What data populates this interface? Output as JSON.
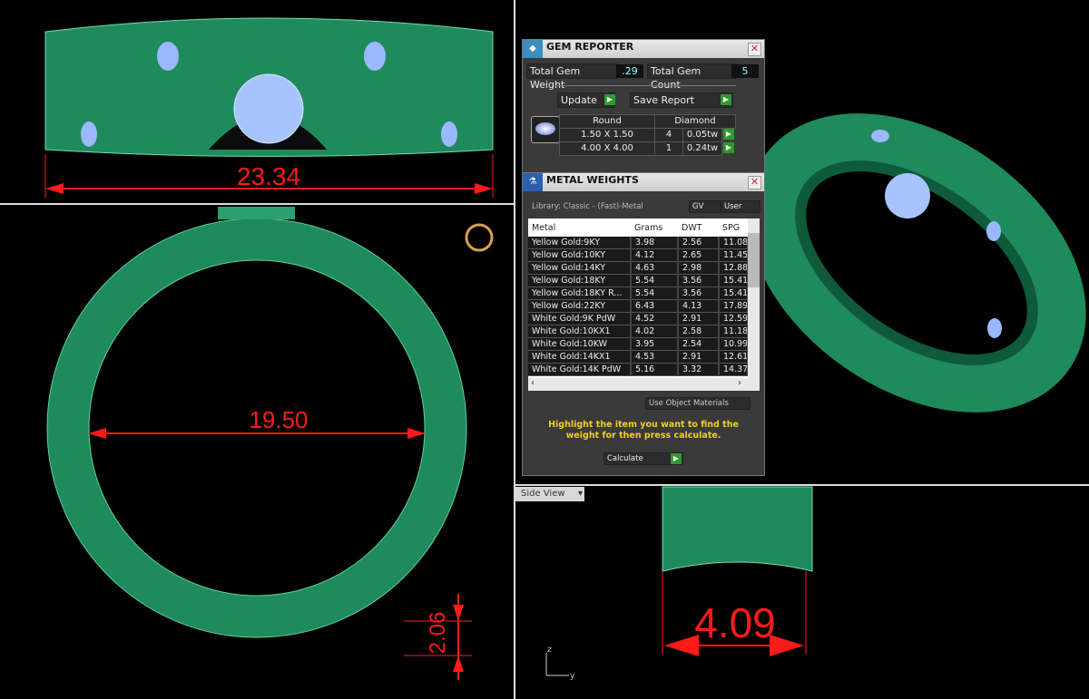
{
  "viewports": {
    "front_dim": "23.34",
    "top_dim": "19.50",
    "thickness_dim": "2.06",
    "side_dim": "4.09",
    "side_view_label": "Side View",
    "axis_z": "z",
    "axis_y": "y"
  },
  "gem_reporter": {
    "title": "GEM REPORTER",
    "total_weight_label": "Total Gem Weight",
    "total_weight": ".29",
    "total_count_label": "Total Gem Count",
    "total_count": "5",
    "update_label": "Update",
    "save_label": "Save Report",
    "shape": "Round",
    "type": "Diamond",
    "rows": [
      {
        "size": "1.50 X 1.50",
        "count": "4",
        "weight": "0.05tw"
      },
      {
        "size": "4.00 X 4.00",
        "count": "1",
        "weight": "0.24tw"
      }
    ]
  },
  "metal_weights": {
    "title": "METAL WEIGHTS",
    "library": "Library: Classic - (Fast)-Metal",
    "gv_label": "GV",
    "user_label": "User",
    "columns": [
      "Metal",
      "Grams",
      "DWT",
      "SPG"
    ],
    "rows": [
      [
        "Yellow Gold:9KY",
        "3.98",
        "2.56",
        "11.08"
      ],
      [
        "Yellow Gold:10KY",
        "4.12",
        "2.65",
        "11.45"
      ],
      [
        "Yellow Gold:14KY",
        "4.63",
        "2.98",
        "12.88"
      ],
      [
        "Yellow Gold:18KY",
        "5.54",
        "3.56",
        "15.41"
      ],
      [
        "Yellow Gold:18KY R...",
        "5.54",
        "3.56",
        "15.41"
      ],
      [
        "Yellow Gold:22KY",
        "6.43",
        "4.13",
        "17.89"
      ],
      [
        "White Gold:9K PdW",
        "4.52",
        "2.91",
        "12.59"
      ],
      [
        "White Gold:10KX1",
        "4.02",
        "2.58",
        "11.18"
      ],
      [
        "White Gold:10KW",
        "3.95",
        "2.54",
        "10.99"
      ],
      [
        "White Gold:14KX1",
        "4.53",
        "2.91",
        "12.61"
      ],
      [
        "White Gold:14K PdW",
        "5.16",
        "3.32",
        "14.37"
      ]
    ],
    "use_object_materials": "Use Object Materials",
    "hint": "Highlight the item you want to find the weight for then press calculate.",
    "calculate_label": "Calculate"
  }
}
